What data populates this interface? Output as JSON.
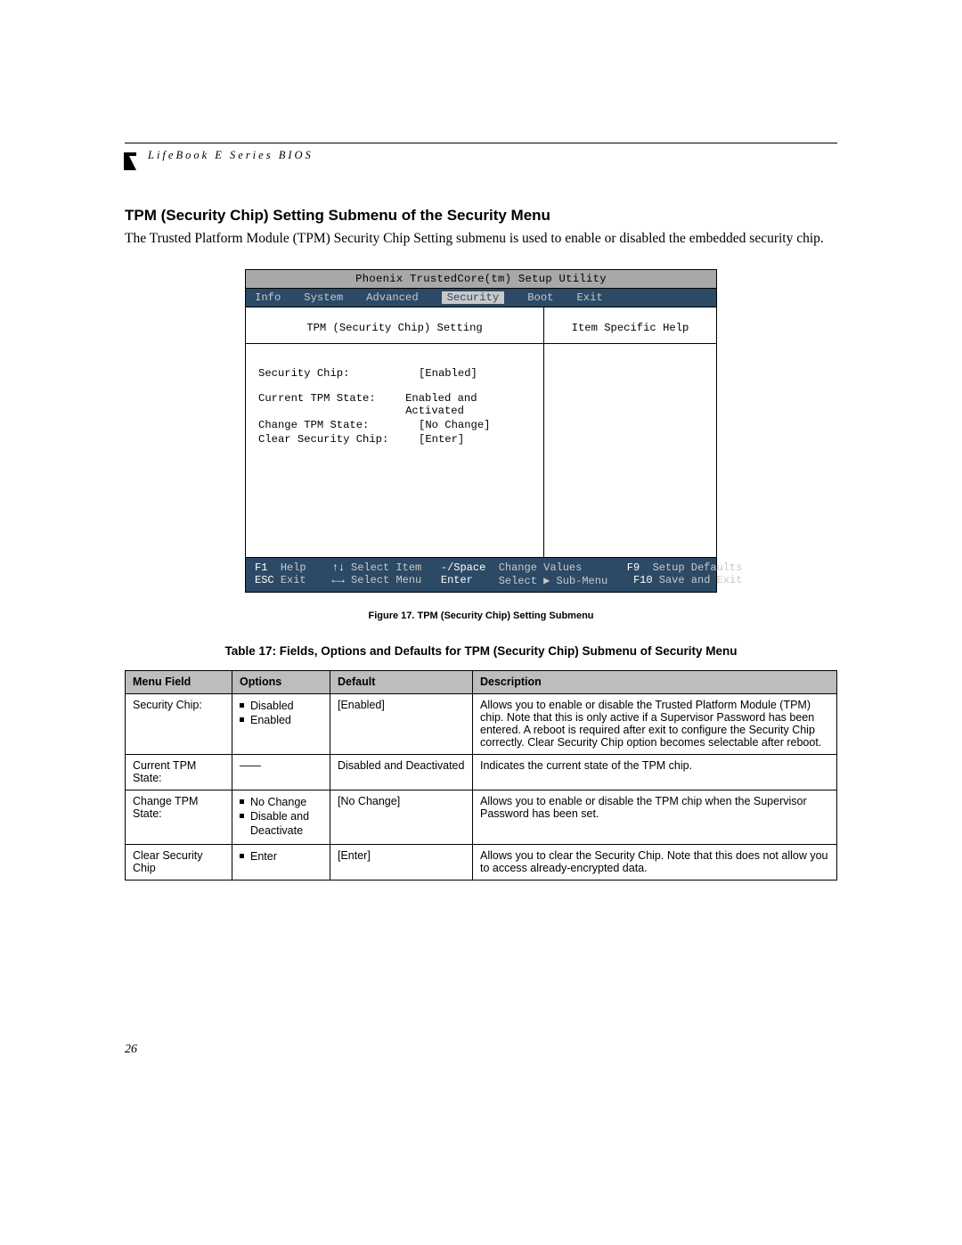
{
  "header": {
    "running": "LifeBook E Series BIOS"
  },
  "title": "TPM (Security Chip) Setting Submenu of the Security Menu",
  "intro": "The Trusted Platform Module (TPM) Security Chip Setting submenu is used to enable or disabled the embedded security chip.",
  "bios": {
    "utility_title": "Phoenix TrustedCore(tm) Setup Utility",
    "menu": {
      "info": "Info",
      "system": "System",
      "advanced": "Advanced",
      "security": "Security",
      "boot": "Boot",
      "exit": "Exit"
    },
    "sub_title": "TPM (Security Chip) Setting",
    "help_title": "Item Specific Help",
    "fields": {
      "security_chip": {
        "label": "Security Chip:",
        "value": "[Enabled]"
      },
      "current_state": {
        "label": "Current TPM State:",
        "value": "Enabled and Activated"
      },
      "change_state": {
        "label": "Change TPM State:",
        "value": "[No Change]"
      },
      "clear_chip": {
        "label": "Clear Security Chip:",
        "value": "[Enter]"
      }
    },
    "footer": {
      "f1": "F1",
      "help": "Help",
      "updown": "↑↓",
      "select_item": "Select Item",
      "minus_space": "-/Space",
      "change_values": "Change Values",
      "f9": "F9",
      "setup_defaults": "Setup Defaults",
      "esc": "ESC",
      "exit": "Exit",
      "leftright": "←→",
      "select_menu": "Select Menu",
      "enter": "Enter",
      "select_sub": "Select ▶ Sub-Menu",
      "f10": "F10",
      "save_exit": "Save and Exit"
    }
  },
  "figure_caption": "Figure 17.  TPM (Security Chip) Setting Submenu",
  "table_caption": "Table 17: Fields, Options and Defaults for TPM (Security Chip) Submenu of Security Menu",
  "table": {
    "headers": {
      "menu_field": "Menu Field",
      "options": "Options",
      "default": "Default",
      "description": "Description"
    },
    "rows": [
      {
        "field": "Security Chip:",
        "options": [
          "Disabled",
          "Enabled"
        ],
        "default": "[Enabled]",
        "desc": "Allows you to enable or disable the Trusted Platform Module (TPM) chip. Note that this is only active if a Supervisor Password has been entered. A reboot is required after exit to configure the Security Chip correctly. Clear Security Chip option becomes selectable after reboot."
      },
      {
        "field": "Current TPM State:",
        "options_dash": "——",
        "default": "Disabled and Deactivated",
        "desc": "Indicates the current state of the TPM chip."
      },
      {
        "field": "Change TPM State:",
        "options": [
          "No Change",
          "Disable and Deactivate"
        ],
        "default": "[No Change]",
        "desc": "Allows you to enable or disable the TPM chip when the Supervisor Password has been set."
      },
      {
        "field": "Clear Security Chip",
        "options": [
          "Enter"
        ],
        "default": "[Enter]",
        "desc": "Allows you to clear the Security Chip. Note that this does not allow you to access already-encrypted data."
      }
    ]
  },
  "page_number": "26"
}
